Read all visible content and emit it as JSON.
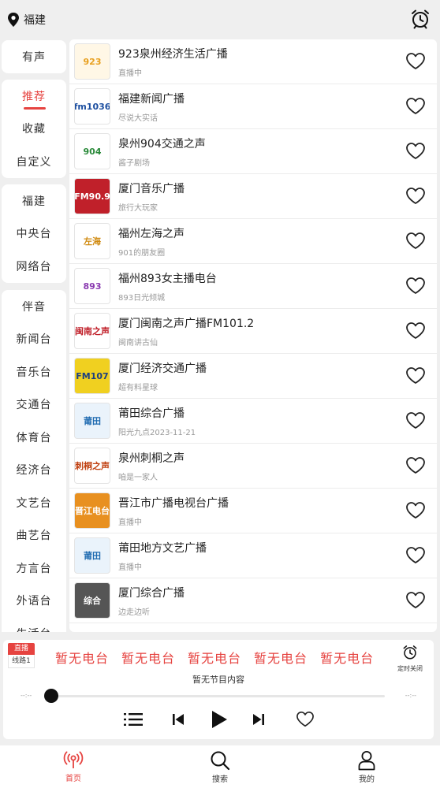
{
  "header": {
    "location": "福建",
    "location_icon": "location-pin-icon",
    "alarm_icon": "alarm-clock-icon"
  },
  "categories": {
    "group1": [
      {
        "label": "有声"
      }
    ],
    "group2": [
      {
        "label": "推荐",
        "active": true
      },
      {
        "label": "收藏"
      },
      {
        "label": "自定义"
      }
    ],
    "group3": [
      {
        "label": "福建"
      },
      {
        "label": "中央台"
      },
      {
        "label": "网络台"
      }
    ],
    "group4": [
      {
        "label": "伴音"
      },
      {
        "label": "新闻台"
      },
      {
        "label": "音乐台"
      },
      {
        "label": "交通台"
      },
      {
        "label": "体育台"
      },
      {
        "label": "经济台"
      },
      {
        "label": "文艺台"
      },
      {
        "label": "曲艺台"
      },
      {
        "label": "方言台"
      },
      {
        "label": "外语台"
      },
      {
        "label": "生活台"
      }
    ]
  },
  "stations": [
    {
      "title": "923泉州经济生活广播",
      "subtitle": "直播中",
      "logo_text": "923",
      "logo_color": "#e8a020",
      "logo_bg": "#fff7e6"
    },
    {
      "title": "福建新闻广播",
      "subtitle": "尽说大实话",
      "logo_text": "fm1036",
      "logo_color": "#1d4fa0",
      "logo_bg": "#ffffff"
    },
    {
      "title": "泉州904交通之声",
      "subtitle": "酱子剧场",
      "logo_text": "904",
      "logo_color": "#2a8a3a",
      "logo_bg": "#ffffff"
    },
    {
      "title": "厦门音乐广播",
      "subtitle": "旅行大玩家",
      "logo_text": "FM90.9",
      "logo_color": "#ffffff",
      "logo_bg": "#c0202a"
    },
    {
      "title": "福州左海之声",
      "subtitle": "901的朋友圈",
      "logo_text": "左海",
      "logo_color": "#d08a10",
      "logo_bg": "#ffffff"
    },
    {
      "title": "福州893女主播电台",
      "subtitle": "893日光倾城",
      "logo_text": "893",
      "logo_color": "#8a3ab0",
      "logo_bg": "#ffffff"
    },
    {
      "title": "厦门闽南之声广播FM101.2",
      "subtitle": "闽南讲古仙",
      "logo_text": "闽南之声",
      "logo_color": "#c0202a",
      "logo_bg": "#ffffff"
    },
    {
      "title": "厦门经济交通广播",
      "subtitle": "超有料星球",
      "logo_text": "FM107",
      "logo_color": "#1d3f80",
      "logo_bg": "#f0d020"
    },
    {
      "title": "莆田综合广播",
      "subtitle": "阳光九点2023-11-21",
      "logo_text": "莆田",
      "logo_color": "#1d6ab0",
      "logo_bg": "#eaf3fb"
    },
    {
      "title": "泉州刺桐之声",
      "subtitle": "咱是一家人",
      "logo_text": "刺桐之声",
      "logo_color": "#c04010",
      "logo_bg": "#ffffff"
    },
    {
      "title": "晋江市广播电视台广播",
      "subtitle": "直播中",
      "logo_text": "晋江电台",
      "logo_color": "#ffffff",
      "logo_bg": "#e89020"
    },
    {
      "title": "莆田地方文艺广播",
      "subtitle": "直播中",
      "logo_text": "莆田",
      "logo_color": "#1d6ab0",
      "logo_bg": "#eaf3fb"
    },
    {
      "title": "厦门综合广播",
      "subtitle": "边走边听",
      "logo_text": "综合",
      "logo_color": "#ffffff",
      "logo_bg": "#555555"
    }
  ],
  "player": {
    "live_label": "直播",
    "line_label": "线路1",
    "marquee": [
      "暂无电台",
      "暂无电台",
      "暂无电台",
      "暂无电台",
      "暂无电台"
    ],
    "program_info": "暂无节目内容",
    "time_left": "--:--",
    "time_right": "--:--",
    "timer_label": "定时关闭",
    "progress": 0
  },
  "nav": [
    {
      "label": "首页",
      "icon": "radio-icon",
      "active": true
    },
    {
      "label": "搜索",
      "icon": "search-icon"
    },
    {
      "label": "我的",
      "icon": "user-icon"
    }
  ],
  "colors": {
    "accent": "#e64340",
    "background": "#efefef"
  }
}
